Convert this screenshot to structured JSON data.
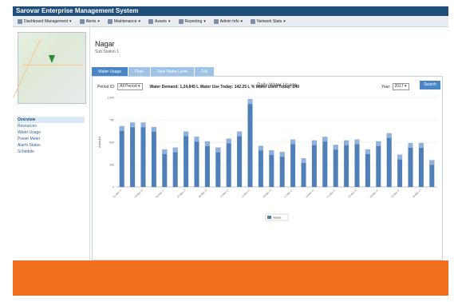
{
  "app": {
    "title": "Sarovar Enterprise Management System"
  },
  "menu": [
    {
      "label": "Dashboard Management"
    },
    {
      "label": "Alerts"
    },
    {
      "label": "Maintenance"
    },
    {
      "label": "Assets"
    },
    {
      "label": "Reporting"
    },
    {
      "label": "Admin Info"
    },
    {
      "label": "Network Stats"
    }
  ],
  "sidebar": {
    "links": [
      {
        "label": "Overview",
        "active": true
      },
      {
        "label": "Resources"
      },
      {
        "label": "Water Usage"
      },
      {
        "label": "Power Meter"
      },
      {
        "label": "Alarm Status"
      },
      {
        "label": "Schedule"
      }
    ]
  },
  "page": {
    "title": "Nagar",
    "subtitle": "Sub Station 1"
  },
  "tabs": [
    {
      "label": "Water Usage",
      "active": true
    },
    {
      "label": "Flow"
    },
    {
      "label": "Tank Water Level"
    },
    {
      "label": "Tds"
    }
  ],
  "filters": {
    "label": "Period ID:",
    "value": "All Period",
    "stats": "Water Demand: 1,24,845 L  Water Use Today: 142.25 L  % Water Used Today: 140",
    "year_label": "Year:",
    "year_value": "2017",
    "search_label": "Search"
  },
  "colors": {
    "bar": "#4f7fb8",
    "bar_top": "#8fb3dc",
    "accent": "#f06f1e",
    "titlebar": "#1f4e79"
  },
  "chart_data": {
    "type": "bar",
    "title": "Daily Water Usage",
    "ylabel": "Amount",
    "ylim": [
      0,
      1000
    ],
    "yticks": [
      "0",
      "250",
      "500",
      "750",
      "1,000"
    ],
    "legend": "Values",
    "categories": [
      "01-Mar-17",
      "02-Mar-17",
      "03-Mar-17",
      "04-Mar-17",
      "05-Mar-17",
      "06-Mar-17",
      "07-Mar-17",
      "08-Mar-17",
      "09-Mar-17",
      "10-Mar-17",
      "11-Mar-17",
      "12-Mar-17",
      "13-Mar-17",
      "14-Mar-17",
      "15-Mar-17",
      "16-Mar-17",
      "17-Mar-17",
      "18-Mar-17",
      "19-Mar-17",
      "20-Mar-17",
      "21-Mar-17",
      "22-Mar-17",
      "23-Mar-17",
      "24-Mar-17",
      "25-Mar-17",
      "26-Mar-17",
      "27-Mar-17",
      "28-Mar-17",
      "29-Mar-17",
      "30-Mar-17"
    ],
    "values": [
      680,
      720,
      720,
      670,
      420,
      440,
      620,
      560,
      510,
      440,
      540,
      620,
      980,
      460,
      410,
      390,
      530,
      320,
      520,
      560,
      470,
      520,
      530,
      420,
      510,
      600,
      360,
      490,
      490,
      300
    ]
  }
}
